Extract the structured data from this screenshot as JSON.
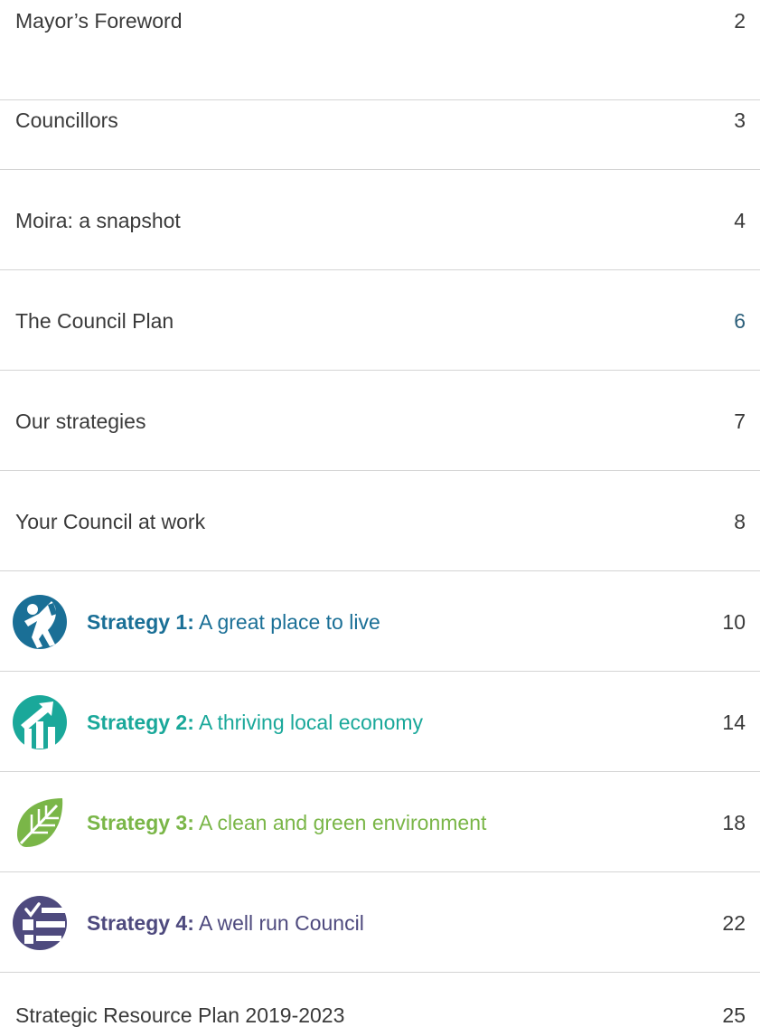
{
  "items": [
    {
      "label": "Mayor’s Foreword",
      "page": "2"
    },
    {
      "label": "Councillors",
      "page": "3"
    },
    {
      "label": "Moira: a snapshot",
      "page": "4"
    },
    {
      "label": "The Council Plan",
      "page": "6",
      "page_color": "#2c5f7a"
    },
    {
      "label": "Our strategies",
      "page": "7"
    },
    {
      "label": "Your Council at work",
      "page": "8"
    },
    {
      "prefix": "Strategy 1:",
      "label": "A great place to live",
      "page": "10",
      "color": "#1a6f96",
      "icon": "person-running-icon"
    },
    {
      "prefix": "Strategy 2:",
      "label": "A thriving local economy",
      "page": "14",
      "color": "#1aa89a",
      "icon": "growth-chart-icon"
    },
    {
      "prefix": "Strategy 3:",
      "label": "A clean and green environment",
      "page": "18",
      "color": "#7ab648",
      "icon": "leaf-icon"
    },
    {
      "prefix": "Strategy 4:",
      "label": " A well run Council",
      "page": "22",
      "color": "#4e4a7e",
      "icon": "checklist-icon"
    },
    {
      "label": "Strategic Resource Plan 2019-2023",
      "page": "25"
    }
  ]
}
